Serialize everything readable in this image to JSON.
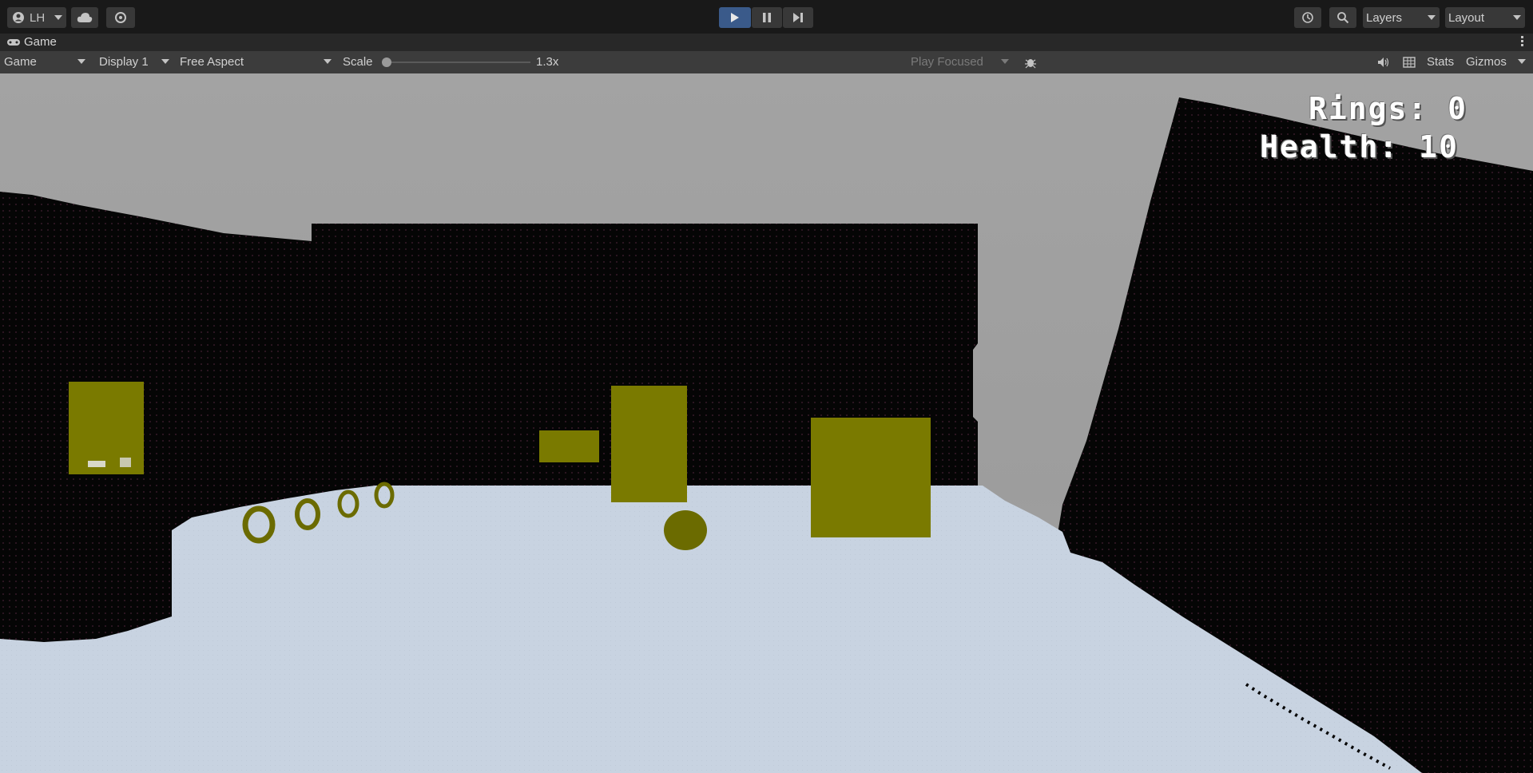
{
  "toolbar": {
    "account_label": "LH",
    "layers_label": "Layers",
    "layout_label": "Layout"
  },
  "tab": {
    "title": "Game"
  },
  "gamebar": {
    "mode": "Game",
    "display": "Display 1",
    "aspect": "Free Aspect",
    "scale_label": "Scale",
    "scale_value": "1.3x",
    "play_mode": "Play Focused",
    "stats_label": "Stats",
    "gizmos_label": "Gizmos"
  },
  "hud": {
    "rings": "Rings: 0",
    "health": "Health: 10"
  },
  "colors": {
    "accent_play": "#3a5a8a",
    "sky": "#a0a0a0",
    "wall": "#050505",
    "floor": "#c8d4e2",
    "object": "#7a7a00"
  },
  "icons": [
    "account-icon",
    "cloud-icon",
    "collab-icon",
    "play-icon",
    "pause-icon",
    "step-icon",
    "history-icon",
    "search-icon",
    "gamepad-icon",
    "more-icon",
    "bug-icon",
    "mute-icon",
    "grid-icon"
  ]
}
